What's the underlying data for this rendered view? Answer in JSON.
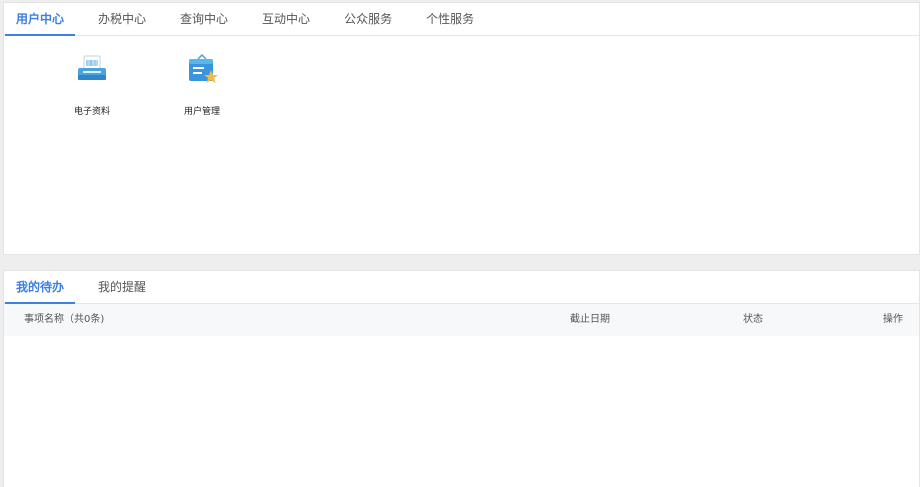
{
  "top_panel": {
    "tabs": [
      {
        "label": "用户中心",
        "active": true
      },
      {
        "label": "办税中心",
        "active": false
      },
      {
        "label": "查询中心",
        "active": false
      },
      {
        "label": "互动中心",
        "active": false
      },
      {
        "label": "公众服务",
        "active": false
      },
      {
        "label": "个性服务",
        "active": false
      }
    ],
    "apps": [
      {
        "label": "电子资料",
        "icon": "printer-icon"
      },
      {
        "label": "用户管理",
        "icon": "user-card-star-icon"
      }
    ]
  },
  "bottom_panel": {
    "tabs": [
      {
        "label": "我的待办",
        "active": true
      },
      {
        "label": "我的提醒",
        "active": false
      }
    ],
    "table": {
      "columns": [
        "事项名称（共0条)",
        "截止日期",
        "状态",
        "操作"
      ]
    }
  },
  "colors": {
    "accent": "#3c7fe6",
    "header_bg": "#f7f8fa",
    "page_bg": "#eeeeee"
  }
}
